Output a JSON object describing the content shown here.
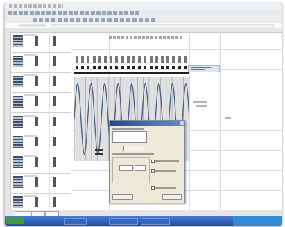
{
  "colors": {
    "window_bg": "#f4f4f4",
    "toolbar_bg": "#e9ecef",
    "chart_bg": "#e0e0e0",
    "waveform": "#4a5f86",
    "dialog_bg": "#ece9d8",
    "dialog_titlebar": "#204a8e",
    "taskbar": "#1f4fa8",
    "start_button": "#3c9a3c"
  },
  "icons": [
    "toolbar-icon",
    "close-icon",
    "start-icon"
  ],
  "waveform": {
    "cycles": 8.5,
    "note": ""
  }
}
